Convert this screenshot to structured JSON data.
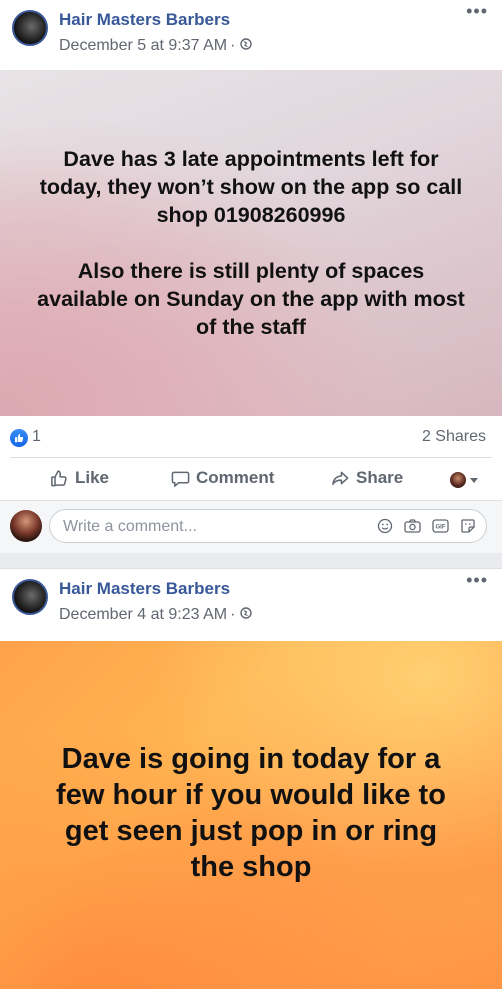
{
  "posts": [
    {
      "author": "Hair Masters Barbers",
      "timestamp": "December 5 at 9:37 AM",
      "separator": "·",
      "banner_paragraphs": [
        "Dave has 3 late appointments left for today, they won’t show on the app so call shop 01908260996",
        "Also there is still plenty of spaces available on Sunday on the app with most of the staff"
      ],
      "reactions_count": "1",
      "shares": "2 Shares",
      "actions": {
        "like": "Like",
        "comment": "Comment",
        "share": "Share"
      },
      "comment_placeholder": "Write a comment..."
    },
    {
      "author": "Hair Masters Barbers",
      "timestamp": "December 4 at 9:23 AM",
      "separator": "·",
      "banner_text": "Dave is going in today for a few hour if you would like to get seen just pop in or ring the shop"
    }
  ],
  "icons": {
    "more": "more-icon",
    "privacy": "globe-icon",
    "like": "thumbs-up-icon",
    "comment": "comment-icon",
    "share": "share-arrow-icon",
    "emoji": "emoji-icon",
    "camera": "camera-icon",
    "gif": "gif-icon",
    "sticker": "sticker-icon"
  },
  "colors": {
    "link_blue": "#385898",
    "meta_grey": "#616770",
    "like_blue": "#1877f2"
  }
}
